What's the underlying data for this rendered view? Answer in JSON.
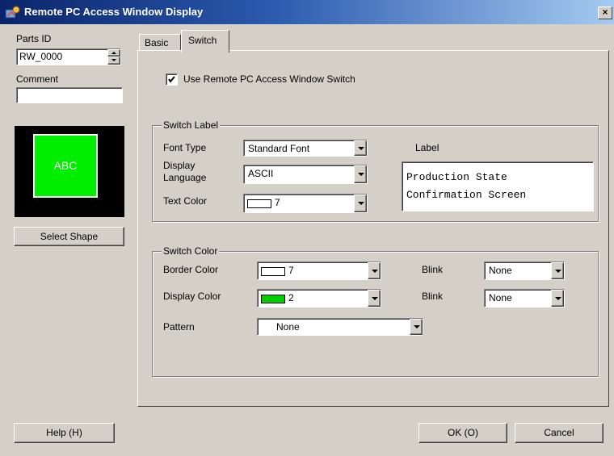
{
  "window": {
    "title": "Remote PC Access Window Display",
    "close_glyph": "×"
  },
  "left_panel": {
    "parts_id_label": "Parts ID",
    "parts_id_value": "RW_0000",
    "comment_label": "Comment",
    "comment_value": "",
    "preview_text": "ABC",
    "select_shape_label": "Select Shape",
    "help_label": "Help (H)"
  },
  "tabs": [
    {
      "label": "Basic"
    },
    {
      "label": "Switch"
    }
  ],
  "switch_tab": {
    "use_switch_label": "Use Remote PC Access Window Switch",
    "use_switch_checked": true,
    "switch_label_group": {
      "title": "Switch Label",
      "font_type_label": "Font Type",
      "font_type_value": "Standard Font",
      "display_language_label_1": "Display",
      "display_language_label_2": "Language",
      "display_language_value": "ASCII",
      "text_color_label": "Text Color",
      "text_color_value": "7",
      "label_title": "Label",
      "label_lines": [
        "Production State",
        "Confirmation Screen"
      ]
    },
    "switch_color_group": {
      "title": "Switch Color",
      "border_color_label": "Border Color",
      "border_color_value": "7",
      "border_blink_label": "Blink",
      "border_blink_value": "None",
      "display_color_label": "Display Color",
      "display_color_value": "2",
      "display_blink_label": "Blink",
      "display_blink_value": "None",
      "pattern_label": "Pattern",
      "pattern_value": "None"
    }
  },
  "footer": {
    "ok_label": "OK (O)",
    "cancel_label": "Cancel"
  },
  "colors": {
    "color_7": "#ffffff",
    "color_2": "#00cc00",
    "preview_bg": "#000000",
    "preview_fill": "#00ee00"
  }
}
